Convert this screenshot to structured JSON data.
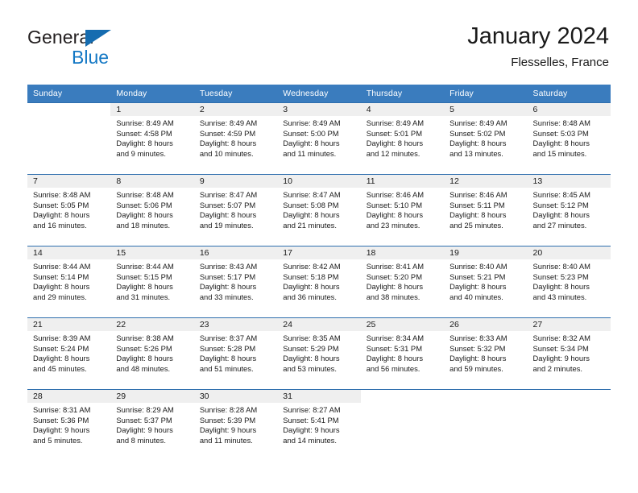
{
  "brand": {
    "name_top": "General",
    "name_bottom": "Blue",
    "accent_color": "#1277c4"
  },
  "header": {
    "title": "January 2024",
    "subtitle": "Flesselles, France",
    "header_bg": "#3a7cbe",
    "divider_color": "#2f6fae",
    "daynum_band_bg": "#efefef"
  },
  "weekday_headers": [
    "Sunday",
    "Monday",
    "Tuesday",
    "Wednesday",
    "Thursday",
    "Friday",
    "Saturday"
  ],
  "labels": {
    "sunrise_prefix": "Sunrise:",
    "sunset_prefix": "Sunset:",
    "daylight_prefix": "Daylight:"
  },
  "weeks": [
    [
      {
        "day": "",
        "line1": "",
        "line2": "",
        "line3": "",
        "line4": ""
      },
      {
        "day": "1",
        "line1": "Sunrise: 8:49 AM",
        "line2": "Sunset: 4:58 PM",
        "line3": "Daylight: 8 hours",
        "line4": "and 9 minutes."
      },
      {
        "day": "2",
        "line1": "Sunrise: 8:49 AM",
        "line2": "Sunset: 4:59 PM",
        "line3": "Daylight: 8 hours",
        "line4": "and 10 minutes."
      },
      {
        "day": "3",
        "line1": "Sunrise: 8:49 AM",
        "line2": "Sunset: 5:00 PM",
        "line3": "Daylight: 8 hours",
        "line4": "and 11 minutes."
      },
      {
        "day": "4",
        "line1": "Sunrise: 8:49 AM",
        "line2": "Sunset: 5:01 PM",
        "line3": "Daylight: 8 hours",
        "line4": "and 12 minutes."
      },
      {
        "day": "5",
        "line1": "Sunrise: 8:49 AM",
        "line2": "Sunset: 5:02 PM",
        "line3": "Daylight: 8 hours",
        "line4": "and 13 minutes."
      },
      {
        "day": "6",
        "line1": "Sunrise: 8:48 AM",
        "line2": "Sunset: 5:03 PM",
        "line3": "Daylight: 8 hours",
        "line4": "and 15 minutes."
      }
    ],
    [
      {
        "day": "7",
        "line1": "Sunrise: 8:48 AM",
        "line2": "Sunset: 5:05 PM",
        "line3": "Daylight: 8 hours",
        "line4": "and 16 minutes."
      },
      {
        "day": "8",
        "line1": "Sunrise: 8:48 AM",
        "line2": "Sunset: 5:06 PM",
        "line3": "Daylight: 8 hours",
        "line4": "and 18 minutes."
      },
      {
        "day": "9",
        "line1": "Sunrise: 8:47 AM",
        "line2": "Sunset: 5:07 PM",
        "line3": "Daylight: 8 hours",
        "line4": "and 19 minutes."
      },
      {
        "day": "10",
        "line1": "Sunrise: 8:47 AM",
        "line2": "Sunset: 5:08 PM",
        "line3": "Daylight: 8 hours",
        "line4": "and 21 minutes."
      },
      {
        "day": "11",
        "line1": "Sunrise: 8:46 AM",
        "line2": "Sunset: 5:10 PM",
        "line3": "Daylight: 8 hours",
        "line4": "and 23 minutes."
      },
      {
        "day": "12",
        "line1": "Sunrise: 8:46 AM",
        "line2": "Sunset: 5:11 PM",
        "line3": "Daylight: 8 hours",
        "line4": "and 25 minutes."
      },
      {
        "day": "13",
        "line1": "Sunrise: 8:45 AM",
        "line2": "Sunset: 5:12 PM",
        "line3": "Daylight: 8 hours",
        "line4": "and 27 minutes."
      }
    ],
    [
      {
        "day": "14",
        "line1": "Sunrise: 8:44 AM",
        "line2": "Sunset: 5:14 PM",
        "line3": "Daylight: 8 hours",
        "line4": "and 29 minutes."
      },
      {
        "day": "15",
        "line1": "Sunrise: 8:44 AM",
        "line2": "Sunset: 5:15 PM",
        "line3": "Daylight: 8 hours",
        "line4": "and 31 minutes."
      },
      {
        "day": "16",
        "line1": "Sunrise: 8:43 AM",
        "line2": "Sunset: 5:17 PM",
        "line3": "Daylight: 8 hours",
        "line4": "and 33 minutes."
      },
      {
        "day": "17",
        "line1": "Sunrise: 8:42 AM",
        "line2": "Sunset: 5:18 PM",
        "line3": "Daylight: 8 hours",
        "line4": "and 36 minutes."
      },
      {
        "day": "18",
        "line1": "Sunrise: 8:41 AM",
        "line2": "Sunset: 5:20 PM",
        "line3": "Daylight: 8 hours",
        "line4": "and 38 minutes."
      },
      {
        "day": "19",
        "line1": "Sunrise: 8:40 AM",
        "line2": "Sunset: 5:21 PM",
        "line3": "Daylight: 8 hours",
        "line4": "and 40 minutes."
      },
      {
        "day": "20",
        "line1": "Sunrise: 8:40 AM",
        "line2": "Sunset: 5:23 PM",
        "line3": "Daylight: 8 hours",
        "line4": "and 43 minutes."
      }
    ],
    [
      {
        "day": "21",
        "line1": "Sunrise: 8:39 AM",
        "line2": "Sunset: 5:24 PM",
        "line3": "Daylight: 8 hours",
        "line4": "and 45 minutes."
      },
      {
        "day": "22",
        "line1": "Sunrise: 8:38 AM",
        "line2": "Sunset: 5:26 PM",
        "line3": "Daylight: 8 hours",
        "line4": "and 48 minutes."
      },
      {
        "day": "23",
        "line1": "Sunrise: 8:37 AM",
        "line2": "Sunset: 5:28 PM",
        "line3": "Daylight: 8 hours",
        "line4": "and 51 minutes."
      },
      {
        "day": "24",
        "line1": "Sunrise: 8:35 AM",
        "line2": "Sunset: 5:29 PM",
        "line3": "Daylight: 8 hours",
        "line4": "and 53 minutes."
      },
      {
        "day": "25",
        "line1": "Sunrise: 8:34 AM",
        "line2": "Sunset: 5:31 PM",
        "line3": "Daylight: 8 hours",
        "line4": "and 56 minutes."
      },
      {
        "day": "26",
        "line1": "Sunrise: 8:33 AM",
        "line2": "Sunset: 5:32 PM",
        "line3": "Daylight: 8 hours",
        "line4": "and 59 minutes."
      },
      {
        "day": "27",
        "line1": "Sunrise: 8:32 AM",
        "line2": "Sunset: 5:34 PM",
        "line3": "Daylight: 9 hours",
        "line4": "and 2 minutes."
      }
    ],
    [
      {
        "day": "28",
        "line1": "Sunrise: 8:31 AM",
        "line2": "Sunset: 5:36 PM",
        "line3": "Daylight: 9 hours",
        "line4": "and 5 minutes."
      },
      {
        "day": "29",
        "line1": "Sunrise: 8:29 AM",
        "line2": "Sunset: 5:37 PM",
        "line3": "Daylight: 9 hours",
        "line4": "and 8 minutes."
      },
      {
        "day": "30",
        "line1": "Sunrise: 8:28 AM",
        "line2": "Sunset: 5:39 PM",
        "line3": "Daylight: 9 hours",
        "line4": "and 11 minutes."
      },
      {
        "day": "31",
        "line1": "Sunrise: 8:27 AM",
        "line2": "Sunset: 5:41 PM",
        "line3": "Daylight: 9 hours",
        "line4": "and 14 minutes."
      },
      {
        "day": "",
        "line1": "",
        "line2": "",
        "line3": "",
        "line4": ""
      },
      {
        "day": "",
        "line1": "",
        "line2": "",
        "line3": "",
        "line4": ""
      },
      {
        "day": "",
        "line1": "",
        "line2": "",
        "line3": "",
        "line4": ""
      }
    ]
  ]
}
